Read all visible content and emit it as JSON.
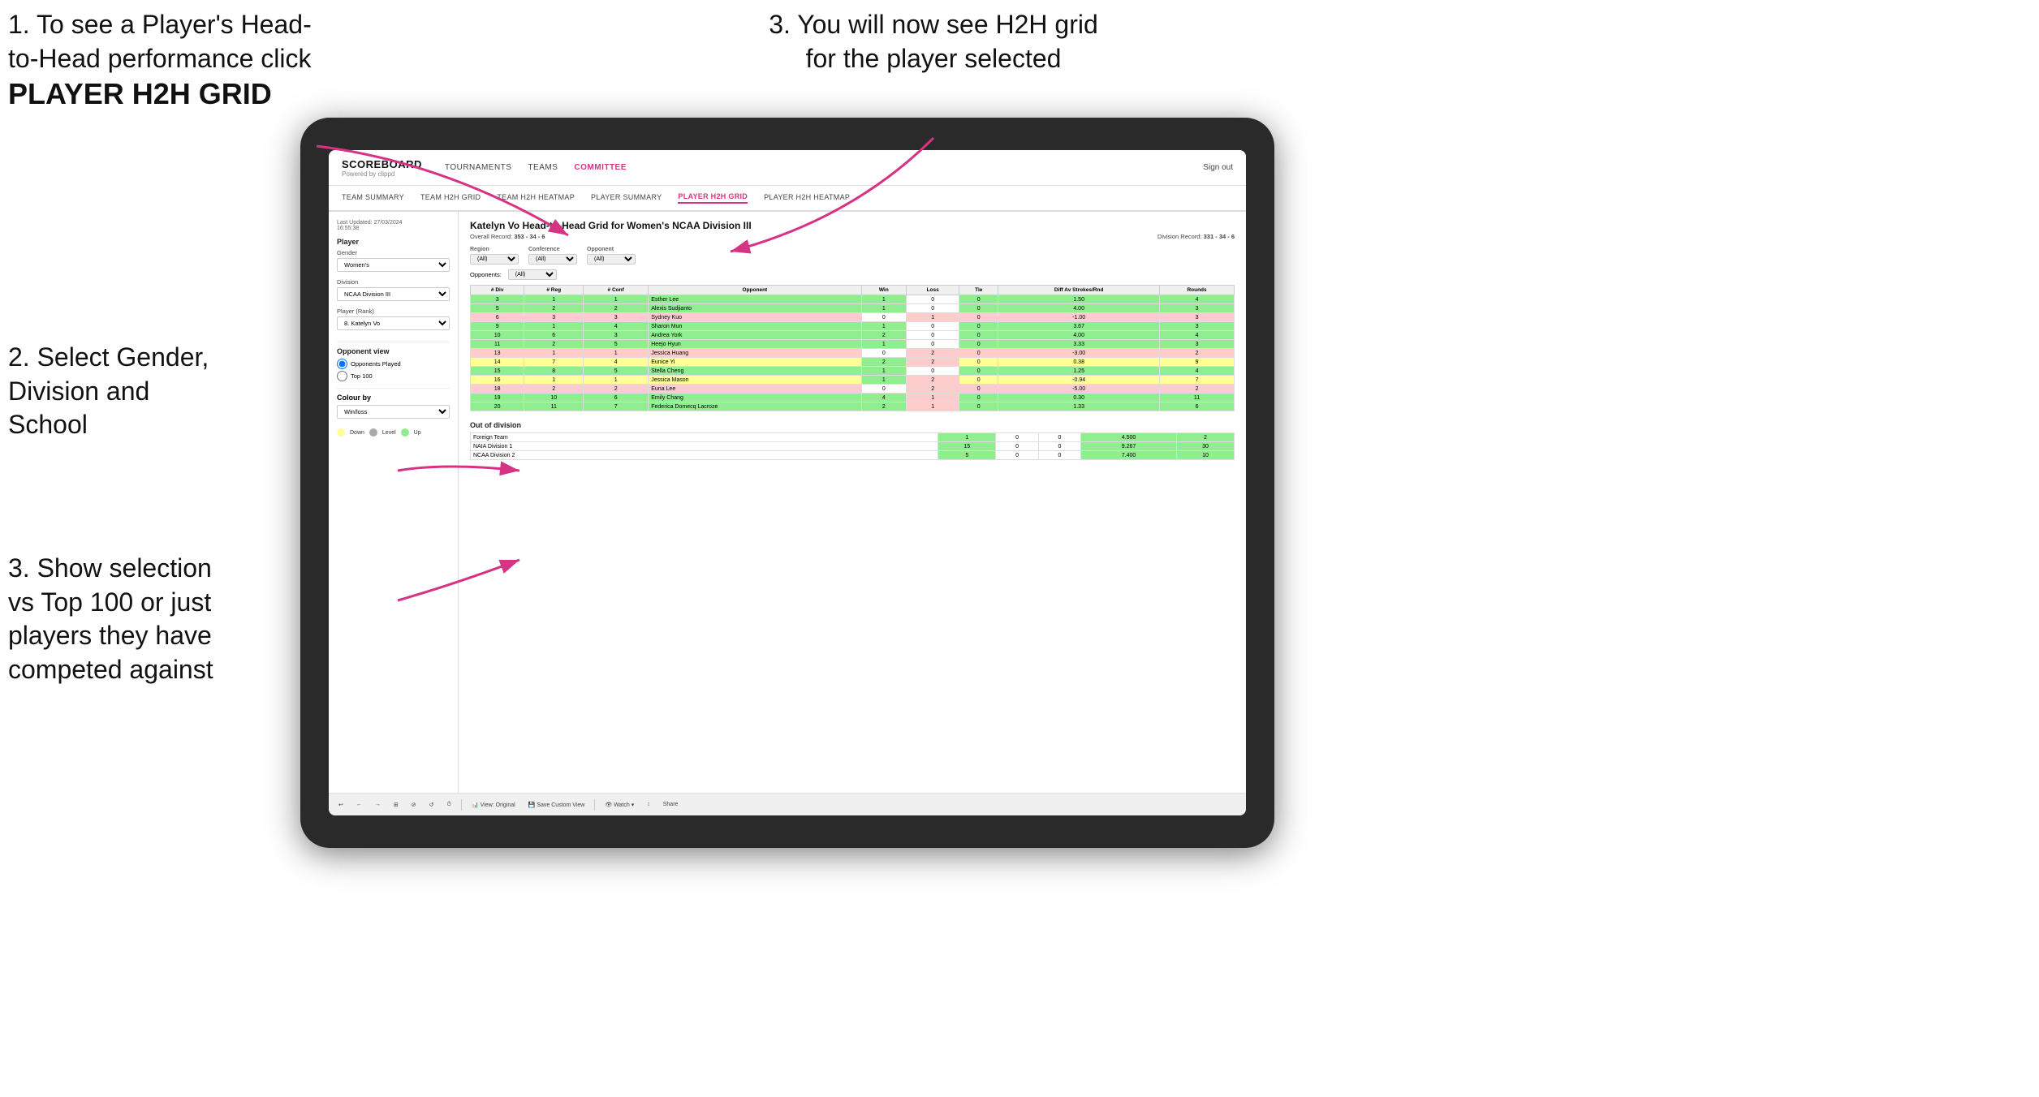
{
  "instructions": {
    "top_left_line1": "1. To see a Player's Head-",
    "top_left_line2": "to-Head performance click",
    "top_left_bold": "PLAYER H2H GRID",
    "top_right": "3. You will now see H2H grid\nfor the player selected",
    "mid_left_title": "2. Select Gender,\nDivision and\nSchool",
    "bottom_left": "3. Show selection\nvs Top 100 or just\nplayers they have\ncompeted against"
  },
  "nav": {
    "logo_main": "SCOREBOARD",
    "logo_sub": "Powered by clippd",
    "links": [
      "TOURNAMENTS",
      "TEAMS",
      "COMMITTEE"
    ],
    "active_link": "COMMITTEE",
    "sign_out": "Sign out"
  },
  "sub_nav": {
    "links": [
      "TEAM SUMMARY",
      "TEAM H2H GRID",
      "TEAM H2H HEATMAP",
      "PLAYER SUMMARY",
      "PLAYER H2H GRID",
      "PLAYER H2H HEATMAP"
    ],
    "active": "PLAYER H2H GRID"
  },
  "left_panel": {
    "timestamp": "Last Updated: 27/03/2024\n16:55:38",
    "player_label": "Player",
    "gender_label": "Gender",
    "gender_value": "Women's",
    "division_label": "Division",
    "division_value": "NCAA Division III",
    "player_rank_label": "Player (Rank)",
    "player_rank_value": "8. Katelyn Vo",
    "opponent_view_label": "Opponent view",
    "radio_1": "Opponents Played",
    "radio_2": "Top 100",
    "colour_by_label": "Colour by",
    "colour_by_value": "Win/loss",
    "legend_down": "Down",
    "legend_level": "Level",
    "legend_up": "Up"
  },
  "data_panel": {
    "title": "Katelyn Vo Head-to-Head Grid for Women's NCAA Division III",
    "overall_record_label": "Overall Record:",
    "overall_record": "353 - 34 - 6",
    "division_record_label": "Division Record:",
    "division_record": "331 - 34 - 6",
    "filter_region_label": "Region",
    "filter_conference_label": "Conference",
    "filter_opponent_label": "Opponent",
    "opponents_label": "Opponents:",
    "opponents_value": "(All)",
    "col_headers": [
      "# Div",
      "# Reg",
      "# Conf",
      "Opponent",
      "Win",
      "Loss",
      "Tie",
      "Diff Av Strokes/Rnd",
      "Rounds"
    ],
    "rows": [
      {
        "div": 3,
        "reg": 1,
        "conf": 1,
        "opponent": "Esther Lee",
        "win": 1,
        "loss": 0,
        "tie": 0,
        "diff": 1.5,
        "rounds": 4,
        "color": "green"
      },
      {
        "div": 5,
        "reg": 2,
        "conf": 2,
        "opponent": "Alexis Sudjianto",
        "win": 1,
        "loss": 0,
        "tie": 0,
        "diff": 4.0,
        "rounds": 3,
        "color": "green"
      },
      {
        "div": 6,
        "reg": 3,
        "conf": 3,
        "opponent": "Sydney Kuo",
        "win": 0,
        "loss": 1,
        "tie": 0,
        "diff": -1.0,
        "rounds": 3,
        "color": "red"
      },
      {
        "div": 9,
        "reg": 1,
        "conf": 4,
        "opponent": "Sharon Mun",
        "win": 1,
        "loss": 0,
        "tie": 0,
        "diff": 3.67,
        "rounds": 3,
        "color": "green"
      },
      {
        "div": 10,
        "reg": 6,
        "conf": 3,
        "opponent": "Andrea York",
        "win": 2,
        "loss": 0,
        "tie": 0,
        "diff": 4.0,
        "rounds": 4,
        "color": "green"
      },
      {
        "div": 11,
        "reg": 2,
        "conf": 5,
        "opponent": "Heejo Hyun",
        "win": 1,
        "loss": 0,
        "tie": 0,
        "diff": 3.33,
        "rounds": 3,
        "color": "green"
      },
      {
        "div": 13,
        "reg": 1,
        "conf": 1,
        "opponent": "Jessica Huang",
        "win": 0,
        "loss": 2,
        "tie": 0,
        "diff": -3.0,
        "rounds": 2,
        "color": "red"
      },
      {
        "div": 14,
        "reg": 7,
        "conf": 4,
        "opponent": "Eunice Yi",
        "win": 2,
        "loss": 2,
        "tie": 0,
        "diff": 0.38,
        "rounds": 9,
        "color": "yellow"
      },
      {
        "div": 15,
        "reg": 8,
        "conf": 5,
        "opponent": "Stella Cheng",
        "win": 1,
        "loss": 0,
        "tie": 0,
        "diff": 1.25,
        "rounds": 4,
        "color": "green"
      },
      {
        "div": 16,
        "reg": 1,
        "conf": 1,
        "opponent": "Jessica Mason",
        "win": 1,
        "loss": 2,
        "tie": 0,
        "diff": -0.94,
        "rounds": 7,
        "color": "yellow"
      },
      {
        "div": 18,
        "reg": 2,
        "conf": 2,
        "opponent": "Euna Lee",
        "win": 0,
        "loss": 2,
        "tie": 0,
        "diff": -5.0,
        "rounds": 2,
        "color": "red"
      },
      {
        "div": 19,
        "reg": 10,
        "conf": 6,
        "opponent": "Emily Chang",
        "win": 4,
        "loss": 1,
        "tie": 0,
        "diff": 0.3,
        "rounds": 11,
        "color": "green"
      },
      {
        "div": 20,
        "reg": 11,
        "conf": 7,
        "opponent": "Federica Domecq Lacroze",
        "win": 2,
        "loss": 1,
        "tie": 0,
        "diff": 1.33,
        "rounds": 6,
        "color": "green"
      }
    ],
    "out_division_title": "Out of division",
    "out_division_rows": [
      {
        "team": "Foreign Team",
        "win": 1,
        "loss": 0,
        "tie": 0,
        "diff": 4.5,
        "rounds": 2
      },
      {
        "team": "NAIA Division 1",
        "win": 15,
        "loss": 0,
        "tie": 0,
        "diff": 9.267,
        "rounds": 30
      },
      {
        "team": "NCAA Division 2",
        "win": 5,
        "loss": 0,
        "tie": 0,
        "diff": 7.4,
        "rounds": 10
      }
    ],
    "toolbar_buttons": [
      "↩",
      "←",
      "→",
      "⊞",
      "⊘",
      "↺",
      "⏱",
      "View: Original",
      "Save Custom View",
      "Watch ▾",
      "↕",
      "Share"
    ]
  }
}
